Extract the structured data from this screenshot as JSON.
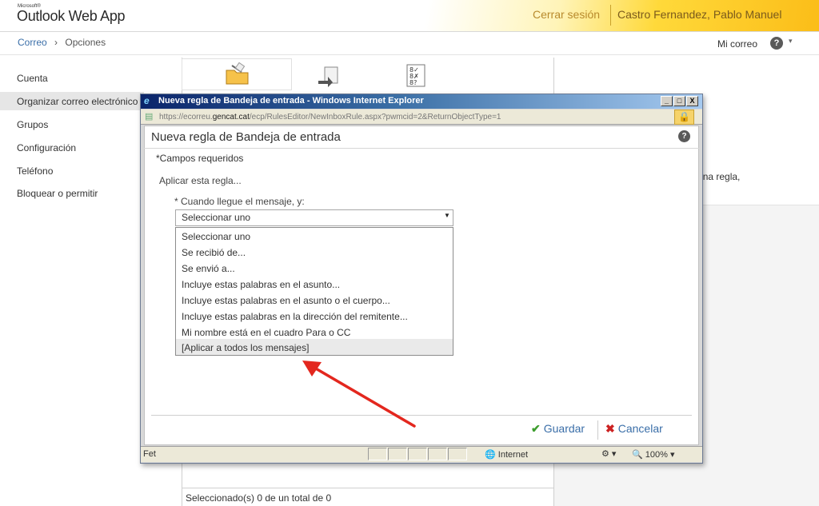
{
  "app": {
    "logo_small": "Microsoft®",
    "logo": "Outlook Web App",
    "sign_out": "Cerrar sesión",
    "user_name": "Castro Fernandez, Pablo Manuel"
  },
  "breadcrumb": {
    "root": "Correo",
    "separator": "›",
    "current": "Opciones"
  },
  "top_right": {
    "my_mail": "Mi correo",
    "help": "?",
    "caret": "▾"
  },
  "sidebar": {
    "items": [
      {
        "label": "Cuenta"
      },
      {
        "label": "Organizar correo electrónico",
        "selected": true
      },
      {
        "label": "Grupos"
      },
      {
        "label": "Configuración"
      },
      {
        "label": "Teléfono"
      },
      {
        "label": "Bloquear o permitir"
      }
    ]
  },
  "background": {
    "right_text": "ute una regla,",
    "status": "Seleccionado(s) 0 de un total de 0",
    "toolbar_icons": [
      "folder-icon",
      "arrow-in-icon",
      "checklist-icon"
    ]
  },
  "popup": {
    "title": "Nueva regla de Bandeja de entrada - Windows Internet Explorer",
    "min": "_",
    "max": "□",
    "close": "X",
    "address_prefix": "https://ecorreu.",
    "address_domain": "gencat.cat",
    "address_suffix": "/ecp/RulesEditor/NewInboxRule.aspx?pwmcid=2&ReturnObjectType=1",
    "lock": "🔒",
    "dialog_title": "Nueva regla de Bandeja de entrada",
    "dialog_help": "?",
    "required": "*Campos requeridos",
    "apply_rule": "Aplicar esta regla...",
    "when_label": "* Cuando llegue el mensaje, y:",
    "select_value": "Seleccionar uno",
    "select_arrow": "▼",
    "options": [
      "Seleccionar uno",
      "Se recibió de...",
      "Se envió a...",
      "Incluye estas palabras en el asunto...",
      "Incluye estas palabras en el asunto o el cuerpo...",
      "Incluye estas palabras en la dirección del remitente...",
      "Mi nombre está en el cuadro Para o CC",
      "[Aplicar a todos los mensajes]"
    ],
    "selected_option_index": 7,
    "save": "Guardar",
    "cancel": "Cancelar",
    "status_left": "Fet",
    "zone": "Internet",
    "zoom": "100%"
  },
  "colors": {
    "accent_link": "#3a6ea8",
    "header_gold": "#fbbd18",
    "arrow_red": "#e3271e",
    "titlebar": "#0a246a"
  }
}
